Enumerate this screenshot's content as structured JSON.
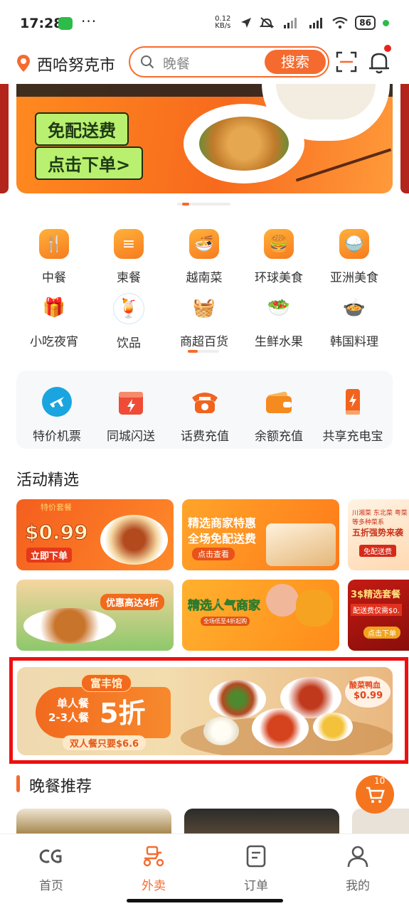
{
  "status_bar": {
    "time": "17:28",
    "dots": "···",
    "net_speed": "0.12 KB/s",
    "battery": "86"
  },
  "header": {
    "city": "西哈努克市",
    "search_placeholder": "晚餐",
    "search_button": "搜索"
  },
  "banner": {
    "tag1": "免配送费",
    "tag2": "点击下单>"
  },
  "categories": [
    {
      "label": "中餐",
      "icon": "fork-spoon-icon"
    },
    {
      "label": "柬餐",
      "icon": "bowl-lines-icon"
    },
    {
      "label": "越南菜",
      "icon": "noodle-bowl-icon"
    },
    {
      "label": "环球美食",
      "icon": "burger-drink-icon"
    },
    {
      "label": "亚洲美食",
      "icon": "rice-bowl-icon"
    },
    {
      "label": "小吃夜宵",
      "icon": "snack-bag-icon"
    },
    {
      "label": "饮品",
      "icon": "drink-cup-icon"
    },
    {
      "label": "商超百货",
      "icon": "shopping-basket-icon"
    },
    {
      "label": "生鲜水果",
      "icon": "fruit-bowl-icon"
    },
    {
      "label": "韩国料理",
      "icon": "korean-bowl-icon"
    }
  ],
  "services": [
    {
      "label": "特价机票",
      "icon": "airplane-icon"
    },
    {
      "label": "同城闪送",
      "icon": "flash-box-icon"
    },
    {
      "label": "话费充值",
      "icon": "phone-icon"
    },
    {
      "label": "余额充值",
      "icon": "wallet-icon"
    },
    {
      "label": "共享充电宝",
      "icon": "power-bank-icon"
    }
  ],
  "activities": {
    "title": "活动精选",
    "cards": [
      {
        "lines": [
          "$0.99",
          "立即下单"
        ],
        "tag": "特价套餐"
      },
      {
        "lines": [
          "精选商家特惠",
          "全场免配送费",
          "点击查看"
        ]
      },
      {
        "lines": [
          "川湘菜 东北菜 粤菜",
          "等多种菜系",
          "五折强势来袭",
          "免配送费"
        ]
      },
      {
        "lines": [
          "优惠高达4折"
        ]
      },
      {
        "lines": [
          "精选人气商家",
          "全场低至4折起购"
        ]
      },
      {
        "lines": [
          "3$精选套餐",
          "配送费仅需$0.",
          "点击下单"
        ]
      }
    ]
  },
  "featured_banner": {
    "brand": "富丰馆",
    "line1": "单人餐",
    "line2": "2-3人餐",
    "discount": "5折",
    "sub": "双人餐只要$6.6",
    "dish_name": "酸菜鸭血",
    "dish_price": "$0.99"
  },
  "recommend": {
    "title": "晚餐推荐"
  },
  "cart": {
    "count": "10"
  },
  "tabs": [
    {
      "label": "首页",
      "icon": "home-logo-icon"
    },
    {
      "label": "外卖",
      "icon": "delivery-scooter-icon"
    },
    {
      "label": "订单",
      "icon": "order-list-icon"
    },
    {
      "label": "我的",
      "icon": "user-icon"
    }
  ],
  "colors": {
    "accent": "#f56b2f",
    "highlight_border": "#ef0f0f"
  }
}
